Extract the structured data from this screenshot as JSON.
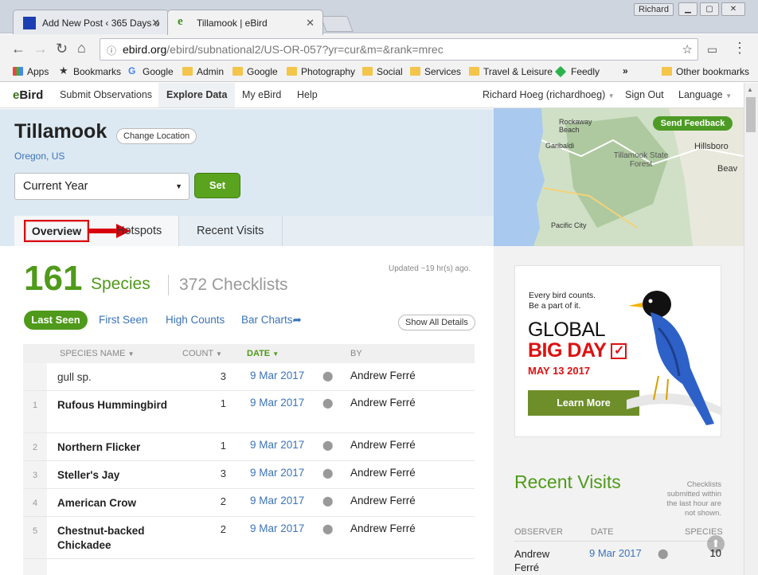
{
  "browser": {
    "tabs": [
      {
        "label": "Add New Post ‹ 365 Days o"
      },
      {
        "label": "Tillamook | eBird"
      }
    ],
    "user": "Richard",
    "url_domain": "ebird.org",
    "url_path": "/ebird/subnational2/US-OR-057?yr=cur&m=&rank=mrec",
    "bookmarks": [
      "Apps",
      "Bookmarks",
      "Google",
      "Admin",
      "Google",
      "Photography",
      "Social",
      "Services",
      "Travel & Leisure",
      "Feedly",
      "»",
      "Other bookmarks"
    ]
  },
  "site": {
    "logo_e": "e",
    "logo_rest": "Bird",
    "nav": [
      "Submit Observations",
      "Explore Data",
      "My eBird",
      "Help"
    ],
    "user_menu": "Richard Hoeg (richardhoeg)",
    "sign_out": "Sign Out",
    "language": "Language"
  },
  "location": {
    "title": "Tillamook",
    "change": "Change Location",
    "region": "Oregon, US",
    "year_select": "Current Year",
    "set": "Set"
  },
  "page_tabs": [
    "Overview",
    "Hotspots",
    "Recent Visits"
  ],
  "map": {
    "feedback": "Send Feedback",
    "labels": [
      "Rockaway Beach",
      "Garibaldi",
      "Tillamook State Forest",
      "Hillsboro",
      "Beav",
      "Pacific City"
    ]
  },
  "summary": {
    "updated": "Updated ~19 hr(s) ago.",
    "species_count": "161",
    "species_label": "Species",
    "checklists": "372 Checklists"
  },
  "subtabs": [
    "Last Seen",
    "First Seen",
    "High Counts",
    "Bar Charts"
  ],
  "show_all": "Show All Details",
  "table": {
    "headers": [
      "SPECIES NAME",
      "COUNT",
      "DATE",
      "BY"
    ],
    "rows": [
      {
        "num": "",
        "name": "gull sp.",
        "count": "3",
        "date": "9 Mar 2017",
        "by": "Andrew Ferré"
      },
      {
        "num": "1",
        "name": "Rufous Hummingbird",
        "count": "1",
        "date": "9 Mar 2017",
        "by": "Andrew Ferré"
      },
      {
        "num": "2",
        "name": "Northern Flicker",
        "count": "1",
        "date": "9 Mar 2017",
        "by": "Andrew Ferré"
      },
      {
        "num": "3",
        "name": "Steller's Jay",
        "count": "3",
        "date": "9 Mar 2017",
        "by": "Andrew Ferré"
      },
      {
        "num": "4",
        "name": "American Crow",
        "count": "2",
        "date": "9 Mar 2017",
        "by": "Andrew Ferré"
      },
      {
        "num": "5",
        "name": "Chestnut-backed Chickadee",
        "count": "2",
        "date": "9 Mar 2017",
        "by": "Andrew Ferré"
      }
    ]
  },
  "ad": {
    "line1": "Every bird counts.",
    "line2": "Be a part of it.",
    "global": "GLOBAL",
    "bigday": "BIG DAY",
    "date": "MAY 13 2017",
    "learn": "Learn More"
  },
  "recent_visits": {
    "title": "Recent Visits",
    "note": "Checklists submitted within the last hour are not shown.",
    "headers": [
      "OBSERVER",
      "DATE",
      "SPECIES"
    ],
    "row": {
      "observer": "Andrew Ferré",
      "date": "9 Mar 2017",
      "species": "10"
    }
  },
  "colors": {
    "brand_green": "#4f9a1a",
    "link_blue": "#3b73b9",
    "highlight_red": "#d9000d"
  }
}
